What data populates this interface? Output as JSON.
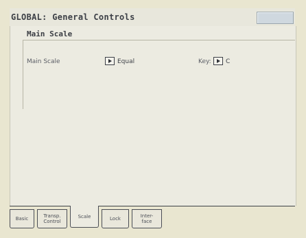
{
  "window": {
    "title": "GLOBAL: General Controls"
  },
  "section": {
    "heading": "Main Scale",
    "fields": [
      {
        "label": "Main Scale",
        "value": "Equal"
      },
      {
        "label": "Key:",
        "value": "C"
      }
    ]
  },
  "tabs": [
    {
      "label": "Basic",
      "active": false
    },
    {
      "label": "Transp.\nControl",
      "active": false
    },
    {
      "label": "Scale",
      "active": true
    },
    {
      "label": "Lock",
      "active": false
    },
    {
      "label": "Inter-\nface",
      "active": false
    }
  ]
}
